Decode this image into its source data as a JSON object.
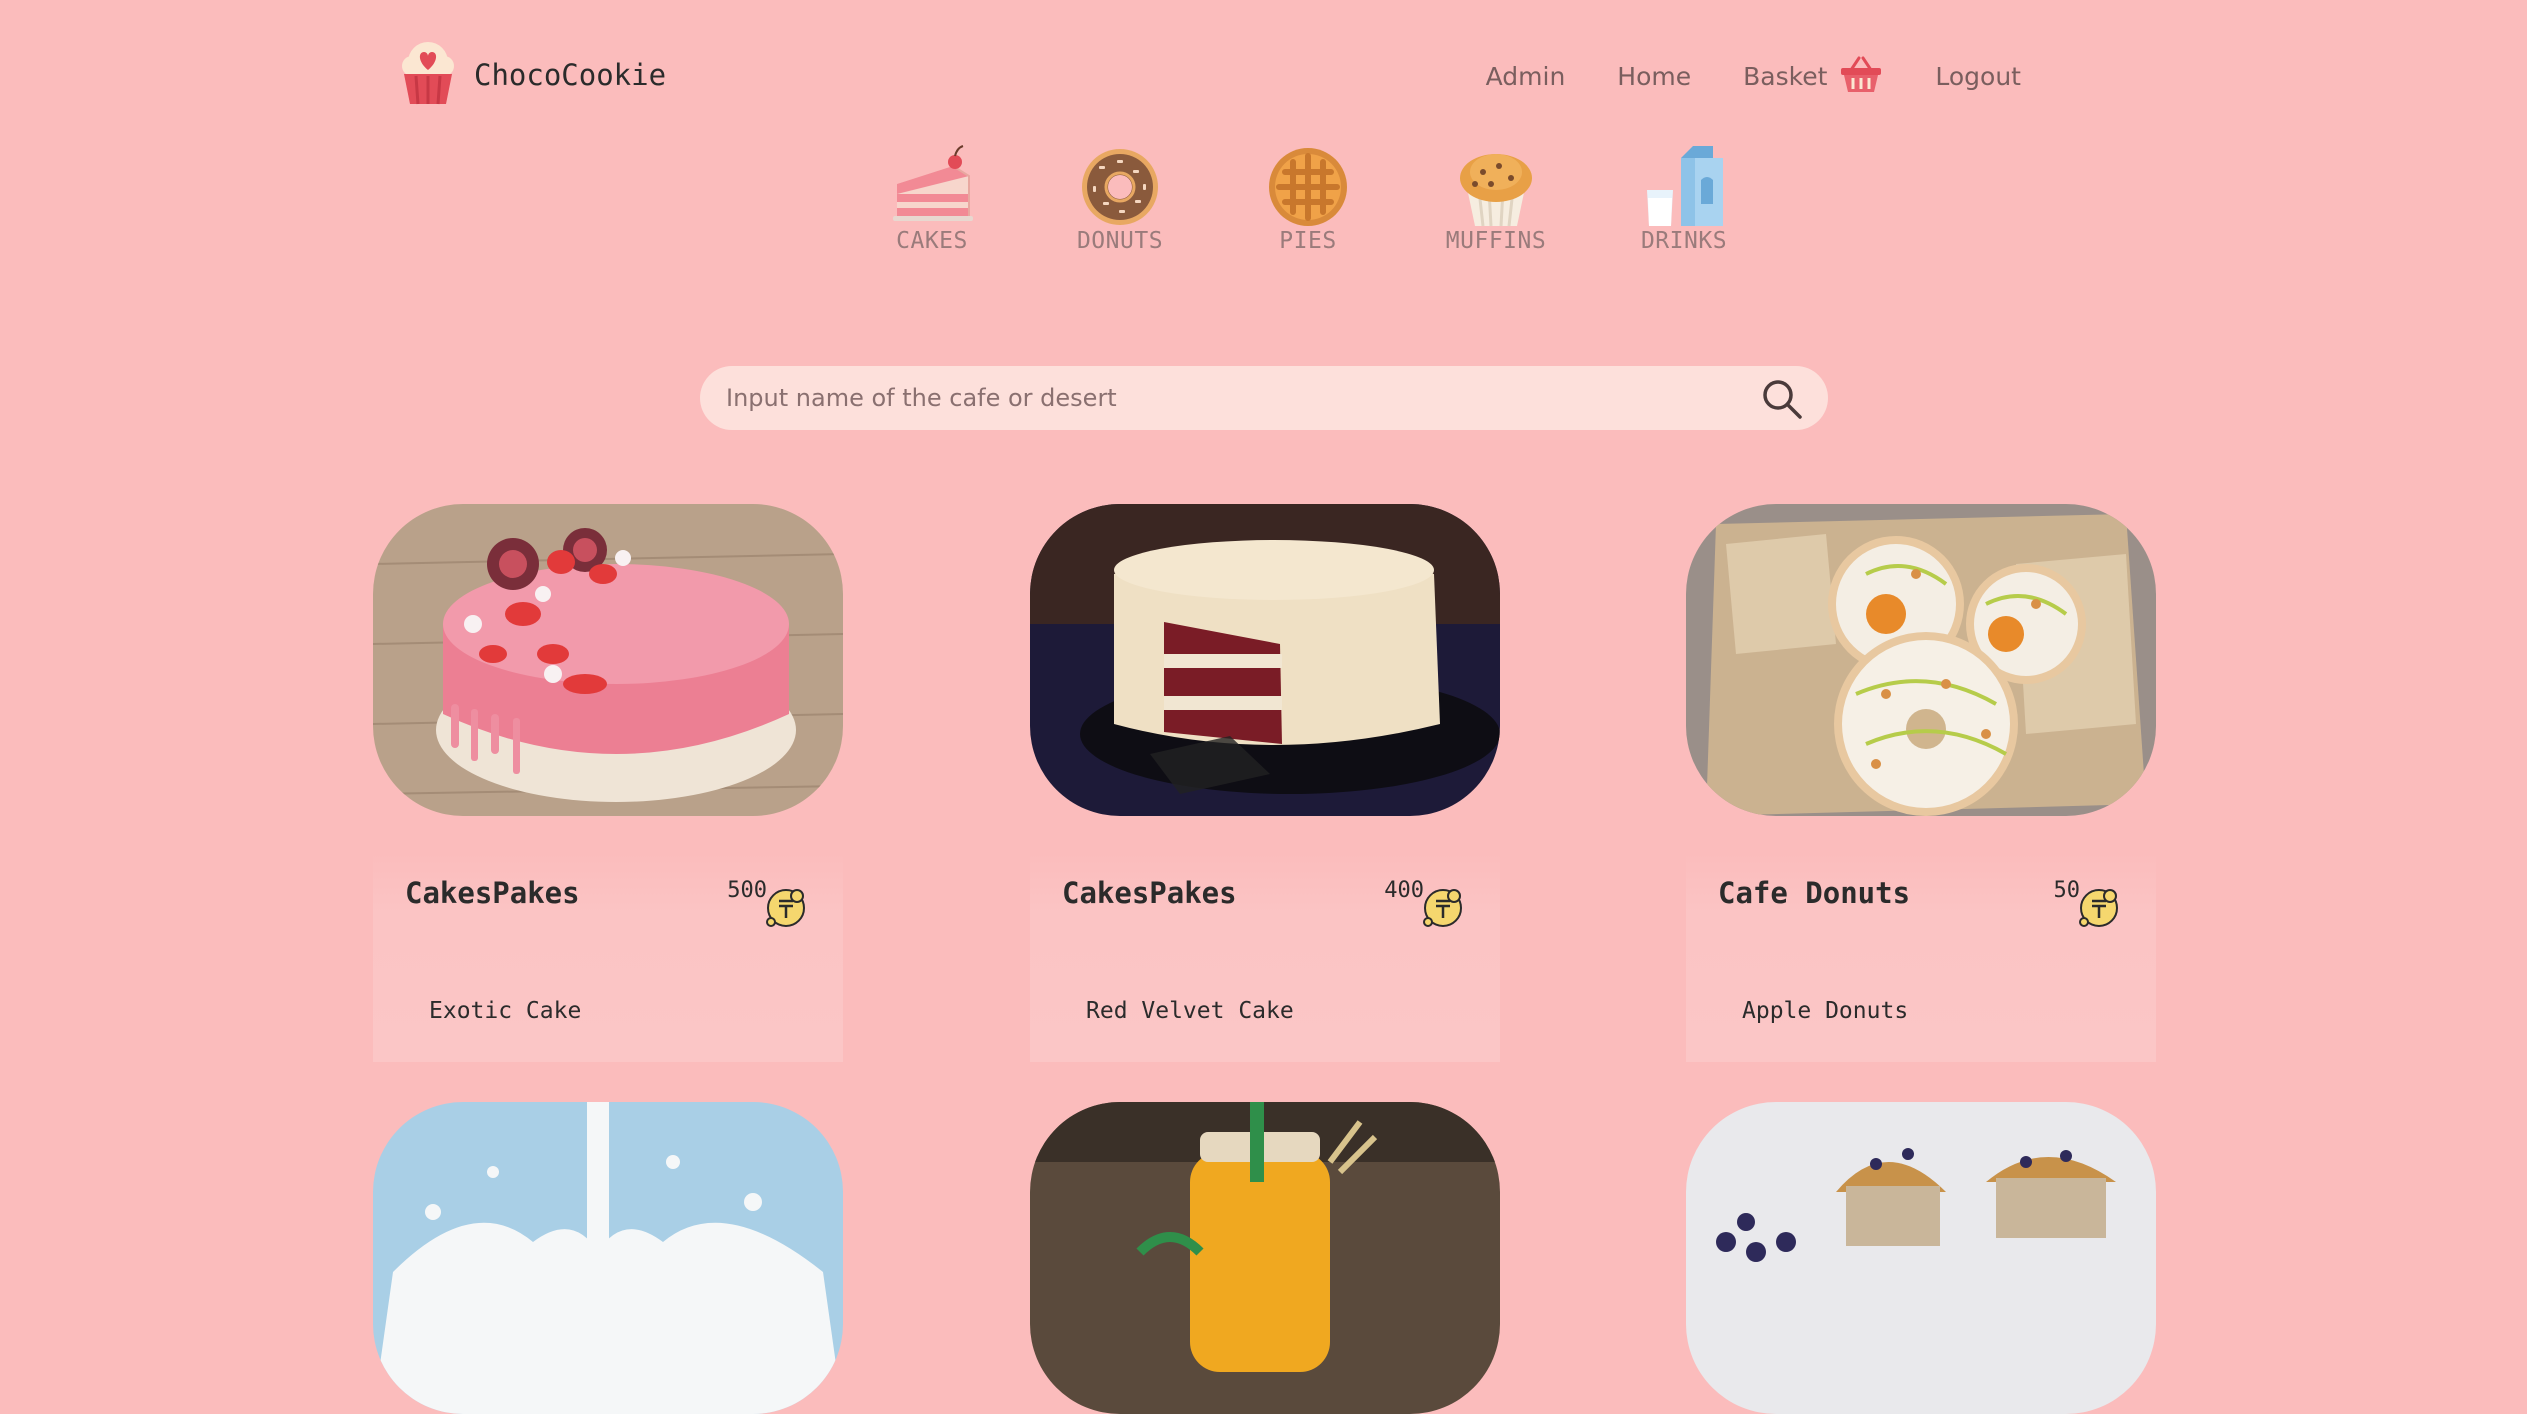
{
  "header": {
    "brand": "ChocoCookie",
    "nav": {
      "admin": "Admin",
      "home": "Home",
      "basket": "Basket",
      "logout": "Logout"
    }
  },
  "categories": [
    {
      "label": "CAKES",
      "icon": "cake-slice-icon"
    },
    {
      "label": "DONUTS",
      "icon": "donut-icon"
    },
    {
      "label": "PIES",
      "icon": "pie-icon"
    },
    {
      "label": "MUFFINS",
      "icon": "muffin-icon"
    },
    {
      "label": "DRINKS",
      "icon": "milk-icon"
    }
  ],
  "search": {
    "placeholder": "Input name of the cafe or desert"
  },
  "cards": [
    {
      "cafe": "CakesPakes",
      "price": "500",
      "item": "Exotic Cake",
      "image": "pink-cake-photo"
    },
    {
      "cafe": "CakesPakes",
      "price": "400",
      "item": "Red Velvet Cake",
      "image": "red-velvet-cake-photo"
    },
    {
      "cafe": "Cafe Donuts",
      "price": "50",
      "item": "Apple Donuts",
      "image": "donuts-photo"
    },
    {
      "image": "milk-splash-photo"
    },
    {
      "image": "orange-juice-photo"
    },
    {
      "image": "blueberry-muffins-photo"
    }
  ],
  "colors": {
    "background": "#fbbcbc",
    "search_bg": "#fde0db",
    "coin": "#f5d76e",
    "text": "#2b2b2b"
  }
}
